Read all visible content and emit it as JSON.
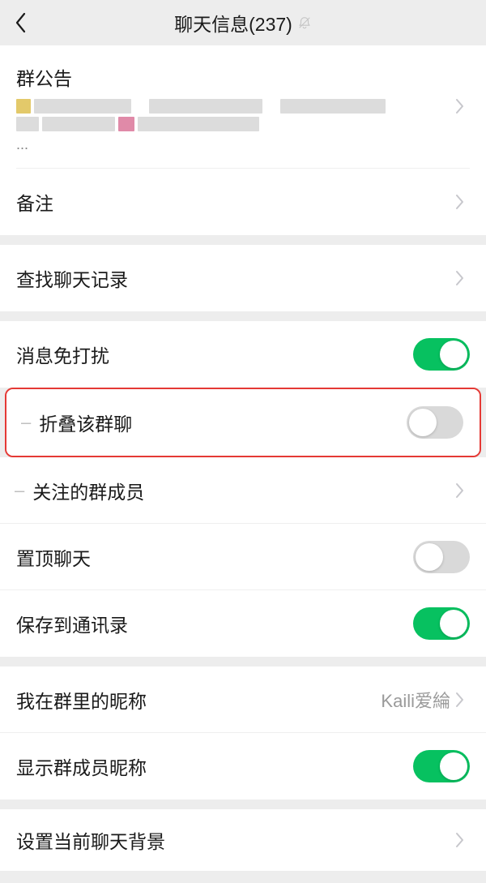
{
  "header": {
    "title": "聊天信息(237)"
  },
  "groups": {
    "notice": {
      "title": "群公告",
      "ellipsis": "..."
    },
    "remark": {
      "label": "备注"
    },
    "search": {
      "label": "查找聊天记录"
    },
    "mute": {
      "label": "消息免打扰",
      "on": true
    },
    "fold": {
      "label": "折叠该群聊",
      "on": false
    },
    "watch": {
      "label": "关注的群成员"
    },
    "top": {
      "label": "置顶聊天",
      "on": false
    },
    "save": {
      "label": "保存到通讯录",
      "on": true
    },
    "alias": {
      "label": "我在群里的昵称",
      "value": "Kaili爱綸"
    },
    "showNick": {
      "label": "显示群成员昵称",
      "on": true
    },
    "bg": {
      "label": "设置当前聊天背景"
    }
  }
}
